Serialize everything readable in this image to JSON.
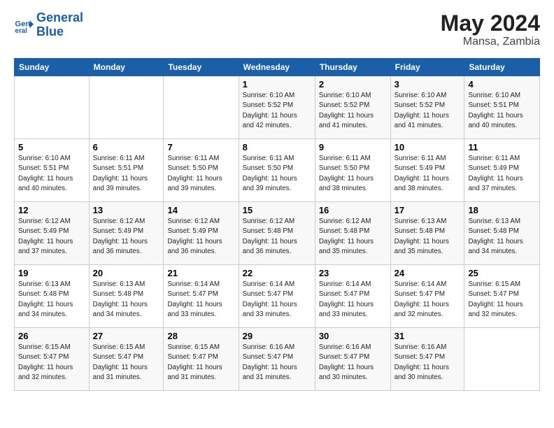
{
  "logo": {
    "line1": "General",
    "line2": "Blue"
  },
  "title": "May 2024",
  "subtitle": "Mansa, Zambia",
  "days_header": [
    "Sunday",
    "Monday",
    "Tuesday",
    "Wednesday",
    "Thursday",
    "Friday",
    "Saturday"
  ],
  "weeks": [
    [
      {
        "day": "",
        "info": ""
      },
      {
        "day": "",
        "info": ""
      },
      {
        "day": "",
        "info": ""
      },
      {
        "day": "1",
        "info": "Sunrise: 6:10 AM\nSunset: 5:52 PM\nDaylight: 11 hours\nand 42 minutes."
      },
      {
        "day": "2",
        "info": "Sunrise: 6:10 AM\nSunset: 5:52 PM\nDaylight: 11 hours\nand 41 minutes."
      },
      {
        "day": "3",
        "info": "Sunrise: 6:10 AM\nSunset: 5:52 PM\nDaylight: 11 hours\nand 41 minutes."
      },
      {
        "day": "4",
        "info": "Sunrise: 6:10 AM\nSunset: 5:51 PM\nDaylight: 11 hours\nand 40 minutes."
      }
    ],
    [
      {
        "day": "5",
        "info": "Sunrise: 6:10 AM\nSunset: 5:51 PM\nDaylight: 11 hours\nand 40 minutes."
      },
      {
        "day": "6",
        "info": "Sunrise: 6:11 AM\nSunset: 5:51 PM\nDaylight: 11 hours\nand 39 minutes."
      },
      {
        "day": "7",
        "info": "Sunrise: 6:11 AM\nSunset: 5:50 PM\nDaylight: 11 hours\nand 39 minutes."
      },
      {
        "day": "8",
        "info": "Sunrise: 6:11 AM\nSunset: 5:50 PM\nDaylight: 11 hours\nand 39 minutes."
      },
      {
        "day": "9",
        "info": "Sunrise: 6:11 AM\nSunset: 5:50 PM\nDaylight: 11 hours\nand 38 minutes."
      },
      {
        "day": "10",
        "info": "Sunrise: 6:11 AM\nSunset: 5:49 PM\nDaylight: 11 hours\nand 38 minutes."
      },
      {
        "day": "11",
        "info": "Sunrise: 6:11 AM\nSunset: 5:49 PM\nDaylight: 11 hours\nand 37 minutes."
      }
    ],
    [
      {
        "day": "12",
        "info": "Sunrise: 6:12 AM\nSunset: 5:49 PM\nDaylight: 11 hours\nand 37 minutes."
      },
      {
        "day": "13",
        "info": "Sunrise: 6:12 AM\nSunset: 5:49 PM\nDaylight: 11 hours\nand 36 minutes."
      },
      {
        "day": "14",
        "info": "Sunrise: 6:12 AM\nSunset: 5:49 PM\nDaylight: 11 hours\nand 36 minutes."
      },
      {
        "day": "15",
        "info": "Sunrise: 6:12 AM\nSunset: 5:48 PM\nDaylight: 11 hours\nand 36 minutes."
      },
      {
        "day": "16",
        "info": "Sunrise: 6:12 AM\nSunset: 5:48 PM\nDaylight: 11 hours\nand 35 minutes."
      },
      {
        "day": "17",
        "info": "Sunrise: 6:13 AM\nSunset: 5:48 PM\nDaylight: 11 hours\nand 35 minutes."
      },
      {
        "day": "18",
        "info": "Sunrise: 6:13 AM\nSunset: 5:48 PM\nDaylight: 11 hours\nand 34 minutes."
      }
    ],
    [
      {
        "day": "19",
        "info": "Sunrise: 6:13 AM\nSunset: 5:48 PM\nDaylight: 11 hours\nand 34 minutes."
      },
      {
        "day": "20",
        "info": "Sunrise: 6:13 AM\nSunset: 5:48 PM\nDaylight: 11 hours\nand 34 minutes."
      },
      {
        "day": "21",
        "info": "Sunrise: 6:14 AM\nSunset: 5:47 PM\nDaylight: 11 hours\nand 33 minutes."
      },
      {
        "day": "22",
        "info": "Sunrise: 6:14 AM\nSunset: 5:47 PM\nDaylight: 11 hours\nand 33 minutes."
      },
      {
        "day": "23",
        "info": "Sunrise: 6:14 AM\nSunset: 5:47 PM\nDaylight: 11 hours\nand 33 minutes."
      },
      {
        "day": "24",
        "info": "Sunrise: 6:14 AM\nSunset: 5:47 PM\nDaylight: 11 hours\nand 32 minutes."
      },
      {
        "day": "25",
        "info": "Sunrise: 6:15 AM\nSunset: 5:47 PM\nDaylight: 11 hours\nand 32 minutes."
      }
    ],
    [
      {
        "day": "26",
        "info": "Sunrise: 6:15 AM\nSunset: 5:47 PM\nDaylight: 11 hours\nand 32 minutes."
      },
      {
        "day": "27",
        "info": "Sunrise: 6:15 AM\nSunset: 5:47 PM\nDaylight: 11 hours\nand 31 minutes."
      },
      {
        "day": "28",
        "info": "Sunrise: 6:15 AM\nSunset: 5:47 PM\nDaylight: 11 hours\nand 31 minutes."
      },
      {
        "day": "29",
        "info": "Sunrise: 6:16 AM\nSunset: 5:47 PM\nDaylight: 11 hours\nand 31 minutes."
      },
      {
        "day": "30",
        "info": "Sunrise: 6:16 AM\nSunset: 5:47 PM\nDaylight: 11 hours\nand 30 minutes."
      },
      {
        "day": "31",
        "info": "Sunrise: 6:16 AM\nSunset: 5:47 PM\nDaylight: 11 hours\nand 30 minutes."
      },
      {
        "day": "",
        "info": ""
      }
    ]
  ]
}
